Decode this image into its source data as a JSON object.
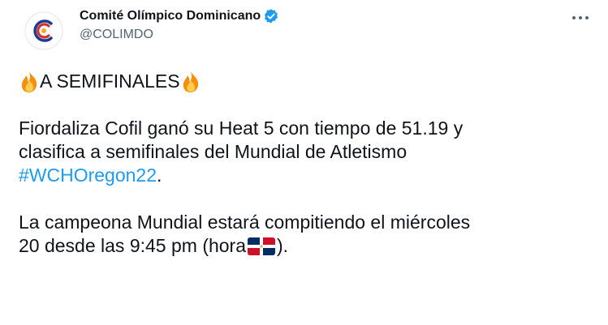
{
  "account": {
    "display_name": "Comité Olímpico Dominicano",
    "handle": "@COLIMDO",
    "verified": true,
    "avatar_icon": "olympic-committee-logo",
    "verified_icon": "verified-badge-icon",
    "more_icon": "more-options-icon"
  },
  "tweet": {
    "headline": "A SEMIFINALES",
    "headline_icon": "fire-emoji",
    "paragraph1_line1": "Fiordaliza Cofil ganó su Heat 5 con tiempo de 51.19 y",
    "paragraph1_line2": "clasifica a semifinales del Mundial de Atletismo",
    "hashtag": "#WCHOregon22",
    "hashtag_suffix": ".",
    "paragraph2_line1": "La campeona Mundial estará compitiendo el miércoles",
    "paragraph2_line2_before": "20 desde las 9:45 pm (hora",
    "paragraph2_line2_flag": "dominican-republic-flag-emoji",
    "paragraph2_line2_after": ")."
  },
  "colors": {
    "text": "#0f1419",
    "secondary": "#536471",
    "link": "#1d9bf0",
    "verified": "#1d9bf0"
  }
}
